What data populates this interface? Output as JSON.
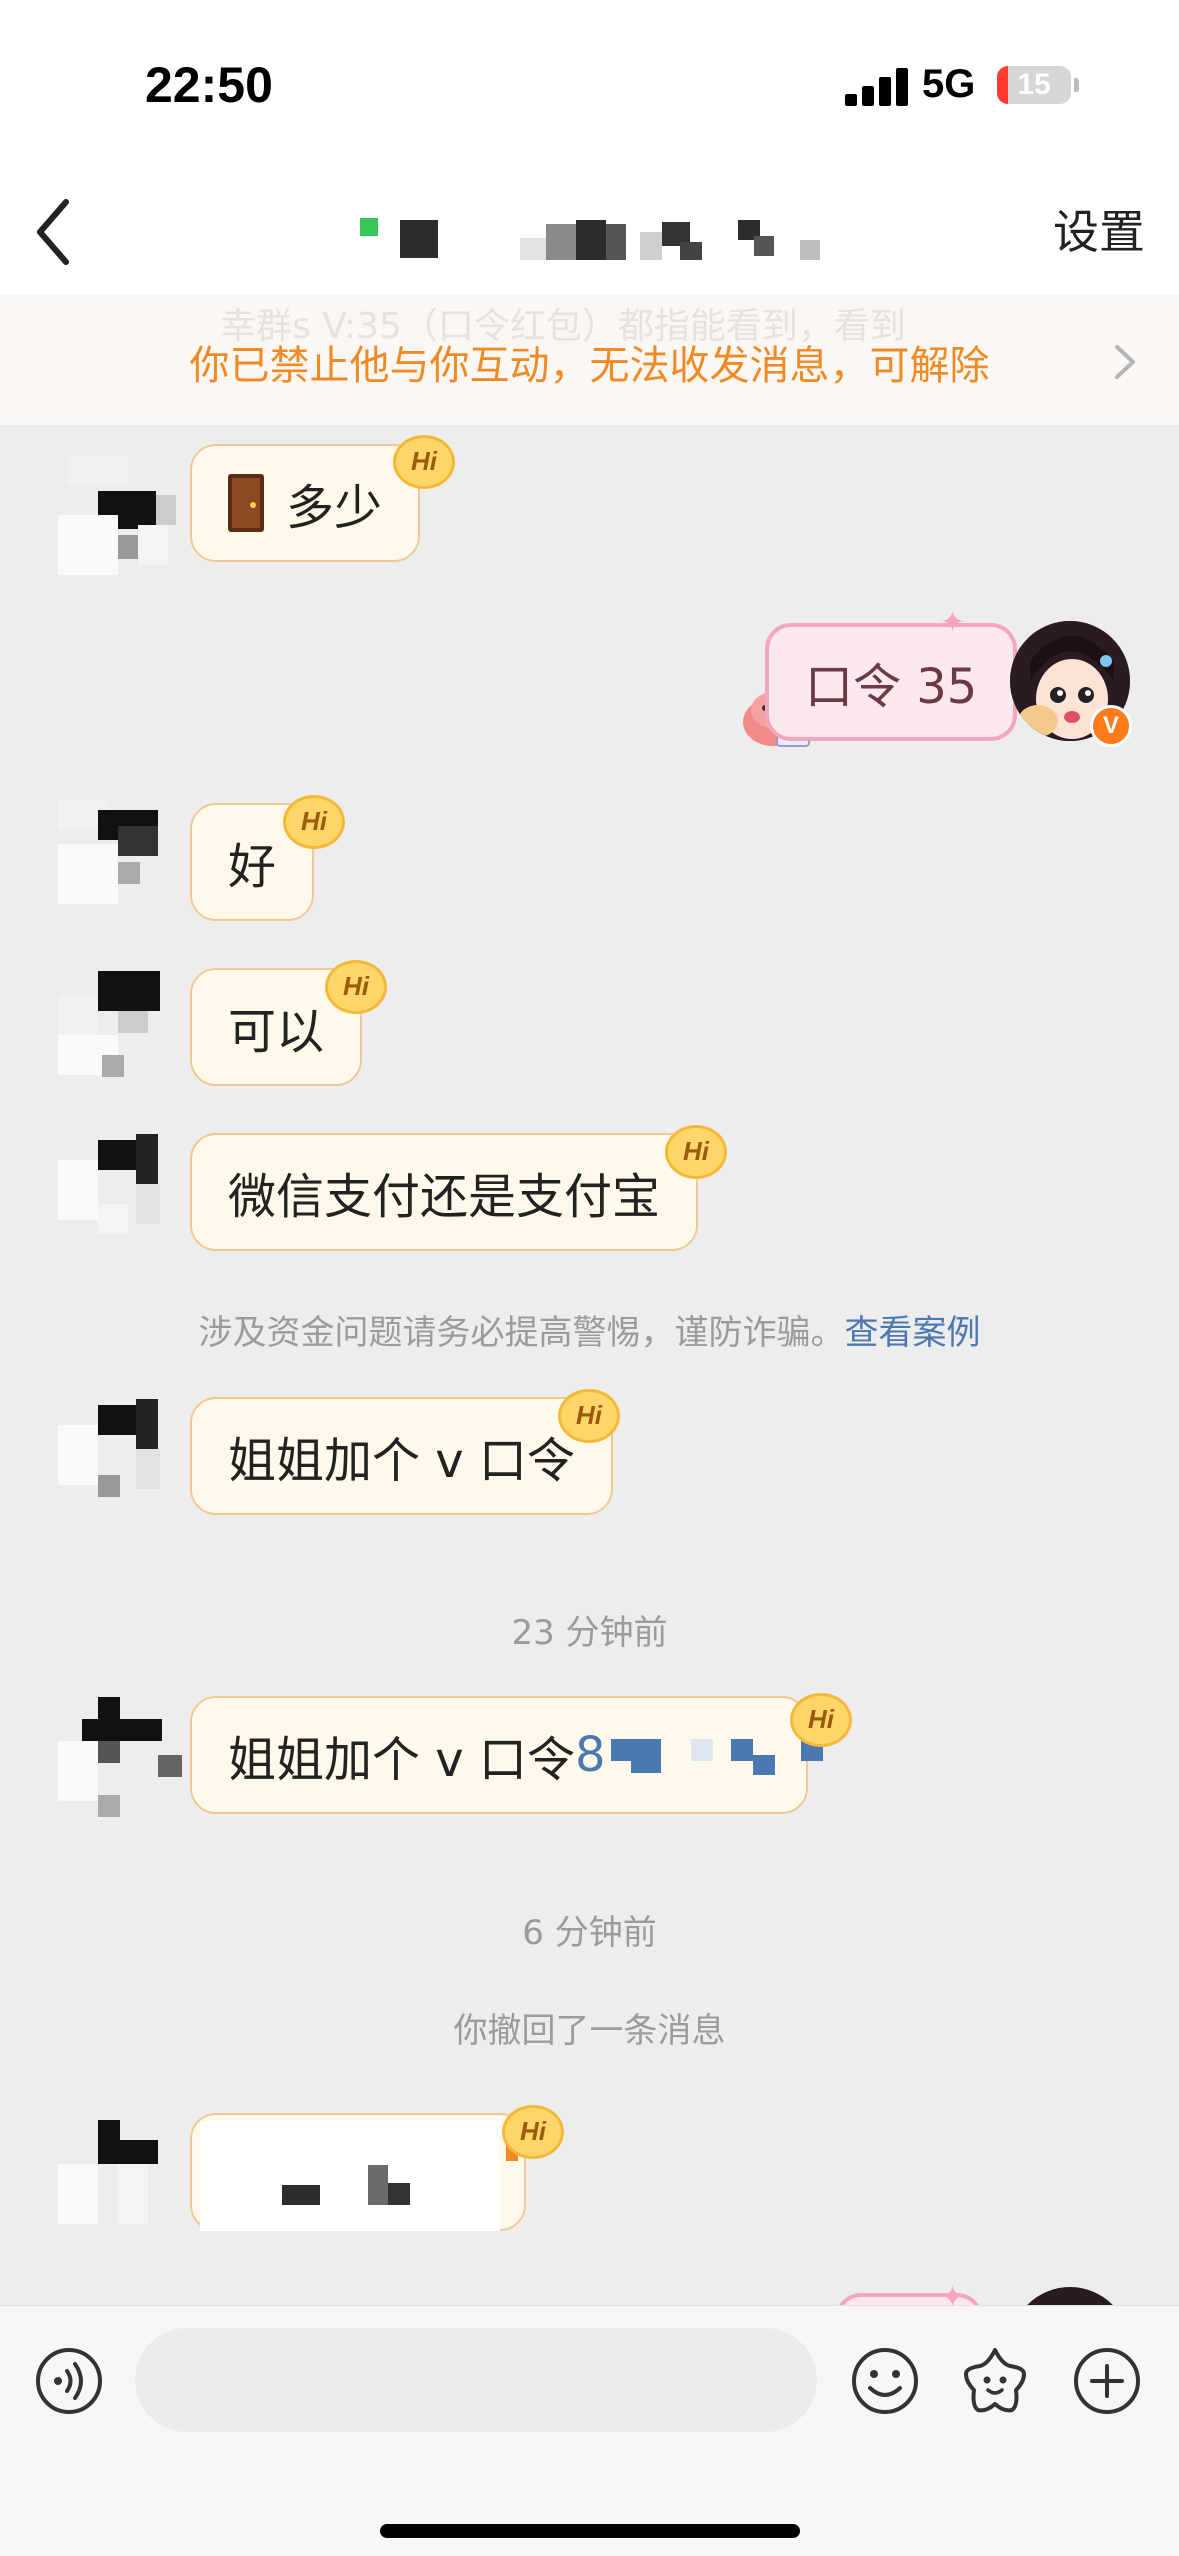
{
  "status_bar": {
    "time": "22:50",
    "network": "5G",
    "battery_level": "15",
    "battery_fraction": 0.15
  },
  "nav": {
    "title": "",
    "settings_label": "设置"
  },
  "banner": {
    "text": "你已禁止他与你互动，无法收发消息，可解除",
    "background_text": "幸群s V:35（口令红包）都指能看到，看到"
  },
  "messages": {
    "m1": {
      "text": "多少",
      "badge": "Hi",
      "icon": "door-icon"
    },
    "m2": {
      "text": "口令 35"
    },
    "m3": {
      "text": "好",
      "badge": "Hi"
    },
    "m4": {
      "text": "可以",
      "badge": "Hi"
    },
    "m5": {
      "text": "微信支付还是支付宝",
      "badge": "Hi"
    },
    "m6": {
      "text": "姐姐加个 v 口令",
      "badge": "Hi"
    },
    "m7": {
      "text": "姐姐加个 v 口令",
      "code_visible": "8",
      "badge": "Hi"
    },
    "m8": {
      "text": "",
      "badge": "Hi"
    }
  },
  "system": {
    "warning_text": "涉及资金问题请务必提高警惕，谨防诈骗。",
    "warning_link": "查看案例",
    "time_1": "23 分钟前",
    "time_2": "6 分钟前",
    "recalled": "你撤回了一条消息"
  },
  "input_bar": {
    "placeholder": "",
    "icons": [
      "voice-icon",
      "emoji-icon",
      "sticker-icon",
      "add-icon"
    ]
  },
  "colors": {
    "accent_orange": "#f08a24",
    "incoming_bubble": "#fff9ec",
    "incoming_border": "#efc895",
    "outgoing_bubble": "#fde8ee",
    "outgoing_border": "#f5a6bc",
    "link_blue": "#4a78b0"
  }
}
